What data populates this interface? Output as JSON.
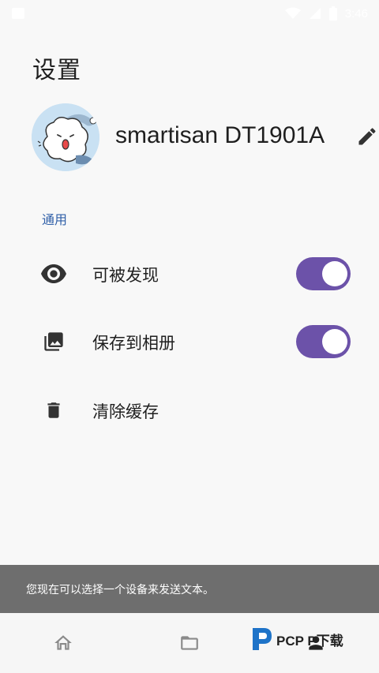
{
  "status_bar": {
    "time": "3:46",
    "icons": [
      "notification-icon",
      "wifi-icon",
      "battery-icon"
    ]
  },
  "header": {
    "title": "设置"
  },
  "profile": {
    "device_name": "smartisan DT1901A",
    "avatar": "cartoon-dog-avatar",
    "edit_icon": "pencil-icon"
  },
  "settings": {
    "section_title": "通用",
    "items": [
      {
        "label": "可被发现",
        "icon": "eye-icon",
        "toggle": true
      },
      {
        "label": "保存到相册",
        "icon": "photo-library-icon",
        "toggle": true
      },
      {
        "label": "清除缓存",
        "icon": "trash-icon",
        "toggle": null
      }
    ]
  },
  "snackbar": {
    "message": "您现在可以选择一个设备来发送文本。"
  },
  "bottom_nav": {
    "items": [
      "home-icon",
      "folder-icon",
      "person-icon"
    ]
  },
  "watermark": {
    "text": "PCP P下载"
  },
  "colors": {
    "accent": "#6c52a9",
    "section_header": "#2f5fa8",
    "background": "#f8f8f8",
    "snackbar": "#6e6e6e"
  }
}
